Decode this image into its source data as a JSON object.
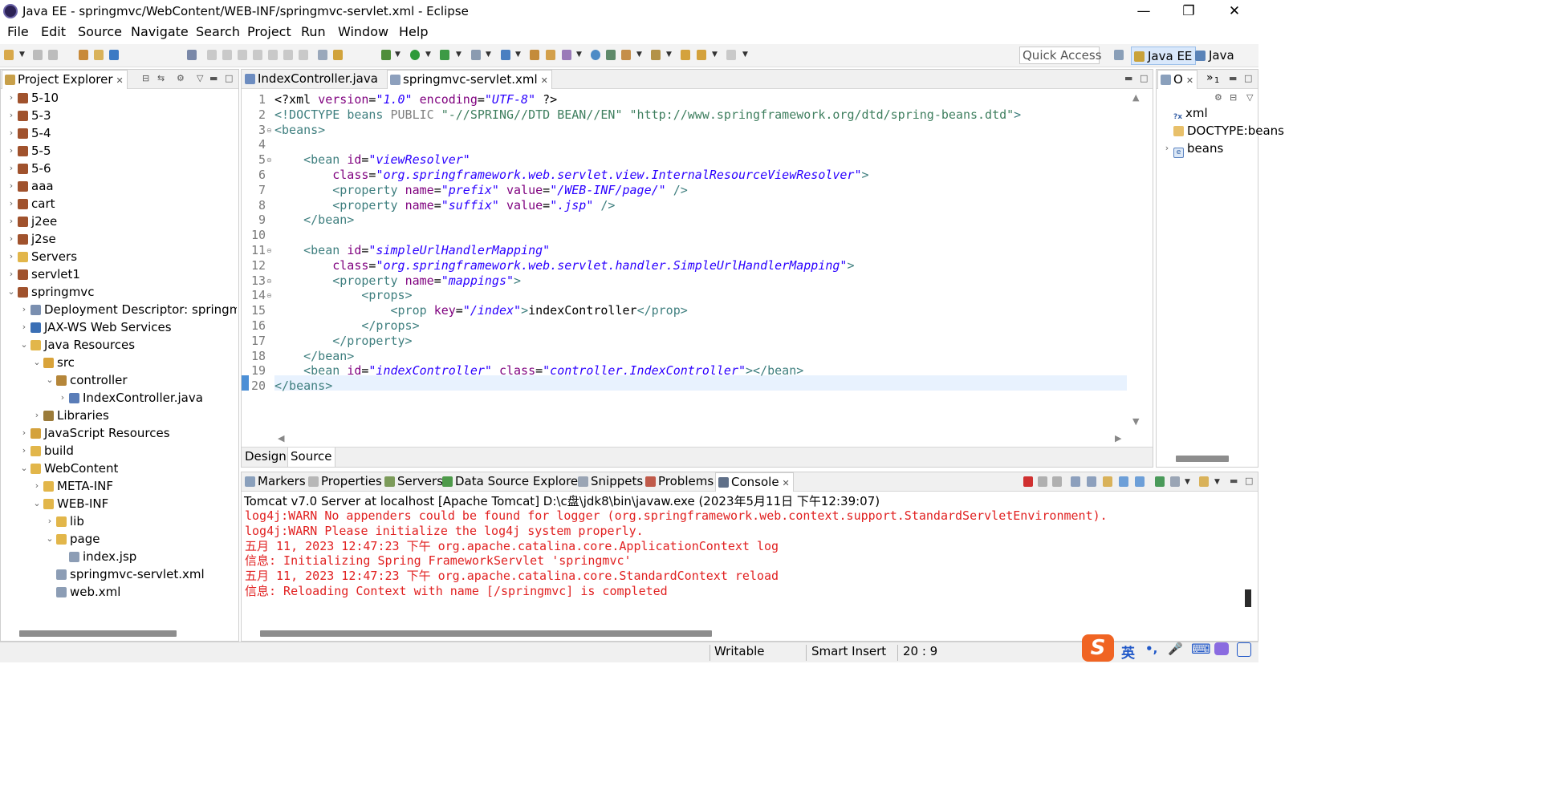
{
  "window": {
    "title": "Java EE - springmvc/WebContent/WEB-INF/springmvc-servlet.xml - Eclipse",
    "controls": {
      "minimize": "—",
      "maximize": "❐",
      "close": "✕"
    }
  },
  "menu": [
    "File",
    "Edit",
    "Source",
    "Navigate",
    "Search",
    "Project",
    "Run",
    "Window",
    "Help"
  ],
  "toolbar": {
    "quick_access": "Quick Access",
    "perspectives": [
      {
        "label": "Java EE",
        "active": true
      },
      {
        "label": "Java",
        "active": false
      }
    ]
  },
  "explorer": {
    "tab": "Project Explorer",
    "close": "✕",
    "items": [
      {
        "label": "5-10",
        "depth": 0,
        "twisty": "›",
        "icon": "project"
      },
      {
        "label": "5-3",
        "depth": 0,
        "twisty": "›",
        "icon": "project"
      },
      {
        "label": "5-4",
        "depth": 0,
        "twisty": "›",
        "icon": "project"
      },
      {
        "label": "5-5",
        "depth": 0,
        "twisty": "›",
        "icon": "project"
      },
      {
        "label": "5-6",
        "depth": 0,
        "twisty": "›",
        "icon": "project"
      },
      {
        "label": "aaa",
        "depth": 0,
        "twisty": "›",
        "icon": "project"
      },
      {
        "label": "cart",
        "depth": 0,
        "twisty": "›",
        "icon": "project"
      },
      {
        "label": "j2ee",
        "depth": 0,
        "twisty": "›",
        "icon": "project"
      },
      {
        "label": "j2se",
        "depth": 0,
        "twisty": "›",
        "icon": "project"
      },
      {
        "label": "Servers",
        "depth": 0,
        "twisty": "›",
        "icon": "folder"
      },
      {
        "label": "servlet1",
        "depth": 0,
        "twisty": "›",
        "icon": "project"
      },
      {
        "label": "springmvc",
        "depth": 0,
        "twisty": "⌄",
        "icon": "project"
      },
      {
        "label": "Deployment Descriptor: springmvc",
        "depth": 1,
        "twisty": "›",
        "icon": "descriptor"
      },
      {
        "label": "JAX-WS Web Services",
        "depth": 1,
        "twisty": "›",
        "icon": "ws"
      },
      {
        "label": "Java Resources",
        "depth": 1,
        "twisty": "⌄",
        "icon": "folder"
      },
      {
        "label": "src",
        "depth": 2,
        "twisty": "⌄",
        "icon": "srcfolder"
      },
      {
        "label": "controller",
        "depth": 3,
        "twisty": "⌄",
        "icon": "package"
      },
      {
        "label": "IndexController.java",
        "depth": 4,
        "twisty": "›",
        "icon": "java"
      },
      {
        "label": "Libraries",
        "depth": 2,
        "twisty": "›",
        "icon": "library"
      },
      {
        "label": "JavaScript Resources",
        "depth": 1,
        "twisty": "›",
        "icon": "js"
      },
      {
        "label": "build",
        "depth": 1,
        "twisty": "›",
        "icon": "folder"
      },
      {
        "label": "WebContent",
        "depth": 1,
        "twisty": "⌄",
        "icon": "folder"
      },
      {
        "label": "META-INF",
        "depth": 2,
        "twisty": "›",
        "icon": "folder"
      },
      {
        "label": "WEB-INF",
        "depth": 2,
        "twisty": "⌄",
        "icon": "folder"
      },
      {
        "label": "lib",
        "depth": 3,
        "twisty": "›",
        "icon": "folder"
      },
      {
        "label": "page",
        "depth": 3,
        "twisty": "⌄",
        "icon": "folder"
      },
      {
        "label": "index.jsp",
        "depth": 4,
        "twisty": "",
        "icon": "jsp"
      },
      {
        "label": "springmvc-servlet.xml",
        "depth": 3,
        "twisty": "",
        "icon": "xml"
      },
      {
        "label": "web.xml",
        "depth": 3,
        "twisty": "",
        "icon": "xml"
      }
    ]
  },
  "editor": {
    "tabs": [
      {
        "label": "IndexController.java",
        "active": false
      },
      {
        "label": "springmvc-servlet.xml",
        "active": true
      }
    ],
    "close": "✕",
    "bottom_tabs": [
      "Design",
      "Source"
    ],
    "active_line": 20,
    "lines": [
      {
        "n": "1",
        "fold": "",
        "tokens": [
          [
            "pi",
            "<?xml "
          ],
          [
            "attr",
            "version"
          ],
          [
            "pi",
            "="
          ],
          [
            "val",
            "\"1.0\""
          ],
          [
            "pi",
            " "
          ],
          [
            "attr",
            "encoding"
          ],
          [
            "pi",
            "="
          ],
          [
            "val",
            "\"UTF-8\""
          ],
          [
            "pi",
            " ?>"
          ]
        ]
      },
      {
        "n": "2",
        "fold": "",
        "tokens": [
          [
            "tag",
            "<!DOCTYPE "
          ],
          [
            "tag",
            "beans "
          ],
          [
            "dtd",
            "PUBLIC "
          ],
          [
            "dtdval",
            "\"-//SPRING//DTD BEAN//EN\" "
          ],
          [
            "dtdval",
            "\"http://www.springframework.org/dtd/spring-beans.dtd\""
          ],
          [
            "tag",
            ">"
          ]
        ]
      },
      {
        "n": "3",
        "fold": "⊖",
        "tokens": [
          [
            "tag",
            "<beans>"
          ]
        ]
      },
      {
        "n": "4",
        "fold": "",
        "tokens": []
      },
      {
        "n": "5",
        "fold": "⊖",
        "tokens": [
          [
            "text",
            "    "
          ],
          [
            "tag",
            "<bean "
          ],
          [
            "attr",
            "id"
          ],
          [
            "text",
            "="
          ],
          [
            "val",
            "\"viewResolver\""
          ]
        ]
      },
      {
        "n": "6",
        "fold": "",
        "tokens": [
          [
            "text",
            "        "
          ],
          [
            "attr",
            "class"
          ],
          [
            "text",
            "="
          ],
          [
            "val",
            "\"org.springframework.web.servlet.view.InternalResourceViewResolver\""
          ],
          [
            "tag",
            ">"
          ]
        ]
      },
      {
        "n": "7",
        "fold": "",
        "tokens": [
          [
            "text",
            "        "
          ],
          [
            "tag",
            "<property "
          ],
          [
            "attr",
            "name"
          ],
          [
            "text",
            "="
          ],
          [
            "val",
            "\"prefix\""
          ],
          [
            "text",
            " "
          ],
          [
            "attr",
            "value"
          ],
          [
            "text",
            "="
          ],
          [
            "val",
            "\"/WEB-INF/page/\""
          ],
          [
            "text",
            " "
          ],
          [
            "tag",
            "/>"
          ]
        ]
      },
      {
        "n": "8",
        "fold": "",
        "tokens": [
          [
            "text",
            "        "
          ],
          [
            "tag",
            "<property "
          ],
          [
            "attr",
            "name"
          ],
          [
            "text",
            "="
          ],
          [
            "val",
            "\"suffix\""
          ],
          [
            "text",
            " "
          ],
          [
            "attr",
            "value"
          ],
          [
            "text",
            "="
          ],
          [
            "val",
            "\".jsp\""
          ],
          [
            "text",
            " "
          ],
          [
            "tag",
            "/>"
          ]
        ]
      },
      {
        "n": "9",
        "fold": "",
        "tokens": [
          [
            "text",
            "    "
          ],
          [
            "tag",
            "</bean>"
          ]
        ]
      },
      {
        "n": "10",
        "fold": "",
        "tokens": []
      },
      {
        "n": "11",
        "fold": "⊖",
        "tokens": [
          [
            "text",
            "    "
          ],
          [
            "tag",
            "<bean "
          ],
          [
            "attr",
            "id"
          ],
          [
            "text",
            "="
          ],
          [
            "val",
            "\"simpleUrlHandlerMapping\""
          ]
        ]
      },
      {
        "n": "12",
        "fold": "",
        "tokens": [
          [
            "text",
            "        "
          ],
          [
            "attr",
            "class"
          ],
          [
            "text",
            "="
          ],
          [
            "val",
            "\"org.springframework.web.servlet.handler.SimpleUrlHandlerMapping\""
          ],
          [
            "tag",
            ">"
          ]
        ]
      },
      {
        "n": "13",
        "fold": "⊖",
        "tokens": [
          [
            "text",
            "        "
          ],
          [
            "tag",
            "<property "
          ],
          [
            "attr",
            "name"
          ],
          [
            "text",
            "="
          ],
          [
            "val",
            "\"mappings\""
          ],
          [
            "tag",
            ">"
          ]
        ]
      },
      {
        "n": "14",
        "fold": "⊖",
        "tokens": [
          [
            "text",
            "            "
          ],
          [
            "tag",
            "<props>"
          ]
        ]
      },
      {
        "n": "15",
        "fold": "",
        "tokens": [
          [
            "text",
            "                "
          ],
          [
            "tag",
            "<prop "
          ],
          [
            "attr",
            "key"
          ],
          [
            "text",
            "="
          ],
          [
            "val",
            "\"/index\""
          ],
          [
            "tag",
            ">"
          ],
          [
            "text",
            "indexController"
          ],
          [
            "tag",
            "</prop>"
          ]
        ]
      },
      {
        "n": "16",
        "fold": "",
        "tokens": [
          [
            "text",
            "            "
          ],
          [
            "tag",
            "</props>"
          ]
        ]
      },
      {
        "n": "17",
        "fold": "",
        "tokens": [
          [
            "text",
            "        "
          ],
          [
            "tag",
            "</property>"
          ]
        ]
      },
      {
        "n": "18",
        "fold": "",
        "tokens": [
          [
            "text",
            "    "
          ],
          [
            "tag",
            "</bean>"
          ]
        ]
      },
      {
        "n": "19",
        "fold": "",
        "tokens": [
          [
            "text",
            "    "
          ],
          [
            "tag",
            "<bean "
          ],
          [
            "attr",
            "id"
          ],
          [
            "text",
            "="
          ],
          [
            "val",
            "\"indexController\""
          ],
          [
            "text",
            " "
          ],
          [
            "attr",
            "class"
          ],
          [
            "text",
            "="
          ],
          [
            "val",
            "\"controller.IndexController\""
          ],
          [
            "tag",
            "></bean>"
          ]
        ]
      },
      {
        "n": "20",
        "fold": "",
        "tokens": [
          [
            "tag",
            "</beans>"
          ]
        ]
      }
    ]
  },
  "outline": {
    "tab": "O",
    "close": "✕",
    "overflow": "»",
    "overflow_count": "1",
    "items": [
      {
        "label": "xml",
        "twisty": "",
        "icon": "?x"
      },
      {
        "label": "DOCTYPE:beans",
        "twisty": "",
        "icon": "doc"
      },
      {
        "label": "beans",
        "twisty": "›",
        "icon": "e"
      }
    ]
  },
  "console_view": {
    "tabs": [
      {
        "label": "Markers",
        "active": false
      },
      {
        "label": "Properties",
        "active": false
      },
      {
        "label": "Servers",
        "active": false
      },
      {
        "label": "Data Source Explorer",
        "active": false
      },
      {
        "label": "Snippets",
        "active": false
      },
      {
        "label": "Problems",
        "active": false
      },
      {
        "label": "Console",
        "active": true
      }
    ],
    "close": "✕",
    "header": "Tomcat v7.0 Server at localhost [Apache Tomcat] D:\\c盘\\jdk8\\bin\\javaw.exe (2023年5月11日 下午12:39:07)",
    "lines": [
      "log4j:WARN No appenders could be found for logger (org.springframework.web.context.support.StandardServletEnvironment).",
      "log4j:WARN Please initialize the log4j system properly.",
      "五月 11, 2023 12:47:23 下午 org.apache.catalina.core.ApplicationContext log",
      "信息: Initializing Spring FrameworkServlet 'springmvc'",
      "五月 11, 2023 12:47:23 下午 org.apache.catalina.core.StandardContext reload",
      "信息: Reloading Context with name [/springmvc] is completed"
    ]
  },
  "status": {
    "writable": "Writable",
    "insert_mode": "Smart Insert",
    "cursor": "20 : 9",
    "ime": {
      "logo": "S",
      "lang": "英",
      "punct": "•,",
      "mic": "🎤",
      "keyboard": "⌨"
    }
  },
  "colors": {
    "console_text": "#e12121",
    "tag": "#3f7f7f",
    "attr": "#7f007f",
    "value": "#2a00ff",
    "active_line_bg": "#e8f2fe",
    "accent": "#2b6fd6"
  }
}
